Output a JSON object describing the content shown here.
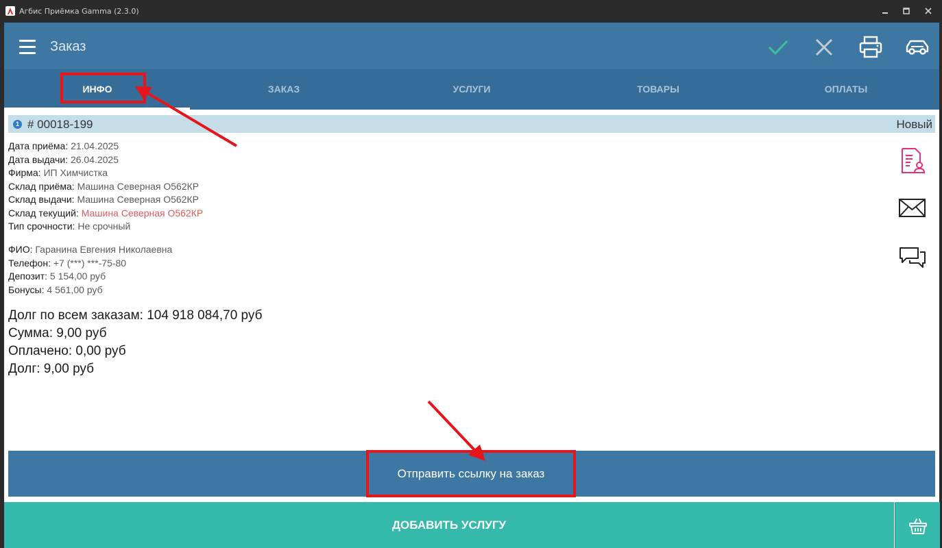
{
  "window": {
    "title": "Агбис Приёмка Gamma (2.3.0)"
  },
  "appbar": {
    "title": "Заказ",
    "icons": [
      "menu-icon",
      "checkmark-icon",
      "close-icon",
      "printer-icon",
      "car-icon"
    ]
  },
  "tabs": [
    {
      "label": "ИНФО",
      "active": true
    },
    {
      "label": "ЗАКАЗ",
      "active": false
    },
    {
      "label": "УСЛУГИ",
      "active": false
    },
    {
      "label": "ТОВАРЫ",
      "active": false
    },
    {
      "label": "ОПЛАТЫ",
      "active": false
    }
  ],
  "order": {
    "badge": "1",
    "number": "# 00018-199",
    "status": "Новый",
    "fields": [
      {
        "label": "Дата приёма:",
        "value": "21.04.2025"
      },
      {
        "label": "Дата выдачи:",
        "value": "26.04.2025"
      },
      {
        "label": "Фирма:",
        "value": "ИП Химчистка"
      },
      {
        "label": "Склад приёма:",
        "value": "Машина Северная О562КР"
      },
      {
        "label": "Склад выдачи:",
        "value": "Машина Северная О562КР"
      },
      {
        "label": "Склад текущий:",
        "value": "Машина Северная О562КР"
      },
      {
        "label": "Тип срочности:",
        "value": "Не срочный"
      }
    ]
  },
  "client": {
    "fields": [
      {
        "label": "ФИО:",
        "value": "Гаранина Евгения Николаевна"
      },
      {
        "label": "Телефон:",
        "value": "+7 (***) ***-75-80"
      },
      {
        "label": "Депозит:",
        "value": "5 154,00 руб"
      },
      {
        "label": "Бонусы:",
        "value": "4 561,00 руб"
      }
    ]
  },
  "totals": [
    "Долг по всем заказам: 104 918 084,70 руб",
    "Сумма: 9,00 руб",
    "Оплачено: 0,00 руб",
    "Долг: 9,00 руб"
  ],
  "side_icons": [
    "client-card-icon",
    "envelope-icon",
    "chat-icon"
  ],
  "buttons": {
    "send_link": "Отправить ссылку на заказ",
    "add_service": "ДОБАВИТЬ УСЛУГУ"
  },
  "colors": {
    "titlebar": "#2b2b2b",
    "appbar": "#3f77a3",
    "tabs": "#356d98",
    "header_bar": "#c5dde9",
    "accent_green": "#35b9aa",
    "check_green": "#3dbf9f",
    "highlight_red": "#e8141c",
    "warehouse_red": "#e25b5b",
    "side_icon_pink": "#e6307e"
  }
}
